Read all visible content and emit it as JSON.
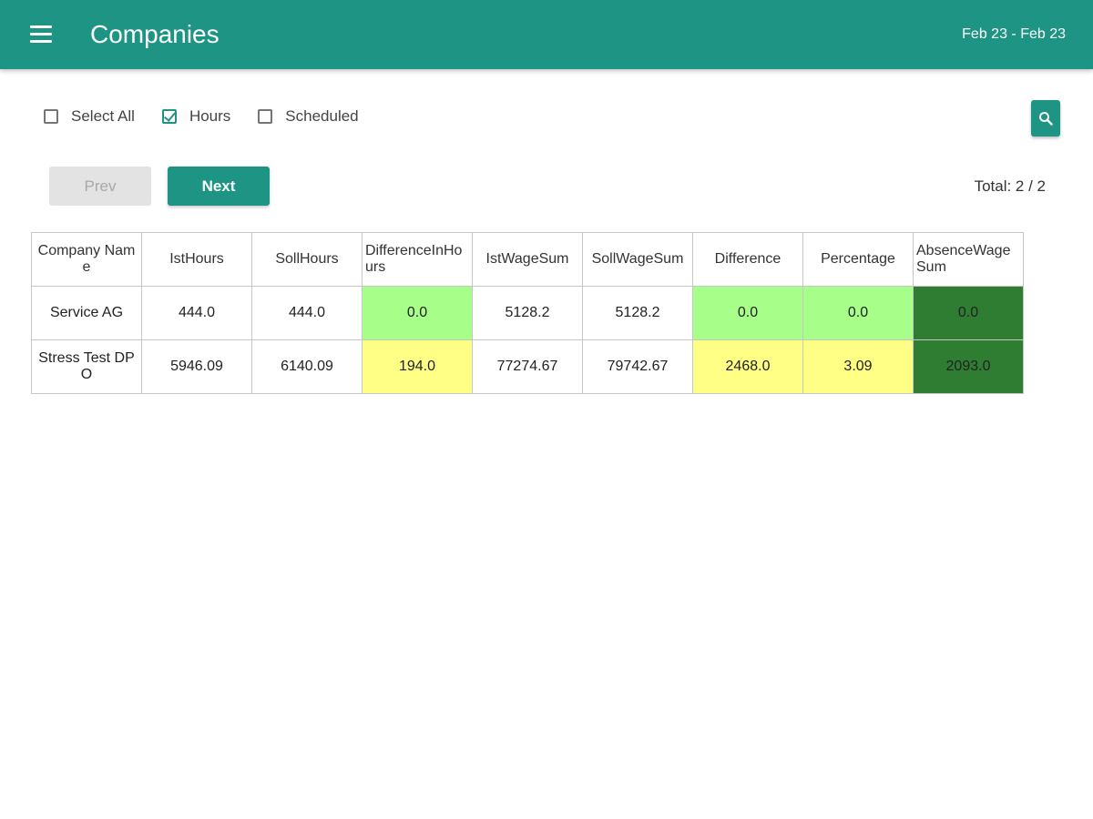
{
  "header": {
    "title": "Companies",
    "date_range": "Feb 23 - Feb 23"
  },
  "filters": [
    {
      "label": "Select All",
      "checked": false
    },
    {
      "label": "Hours",
      "checked": true
    },
    {
      "label": "Scheduled",
      "checked": false
    }
  ],
  "pagination": {
    "prev_label": "Prev",
    "next_label": "Next",
    "total": "Total: 2 / 2"
  },
  "table": {
    "columns": [
      "Company Name",
      "IstHours",
      "SollHours",
      "DifferenceInHours",
      "IstWageSum",
      "SollWageSum",
      "Difference",
      "Percentage",
      "AbsenceWageSum"
    ],
    "rows": [
      [
        "Service AG",
        "444.0",
        "444.0",
        "0.0",
        "5128.2",
        "5128.2",
        "0.0",
        "0.0",
        "0.0"
      ],
      [
        "Stress Test DPO",
        "5946.09",
        "6140.09",
        "194.0",
        "77274.67",
        "79742.67",
        "2468.0",
        "3.09",
        "2093.0"
      ]
    ]
  },
  "colors": {
    "primary": "#1e9584",
    "highlight_ok": "#a7ff8a",
    "highlight_warn": "#ffff85",
    "highlight_absence": "#2e7d32"
  },
  "icons": {
    "menu": "menu-icon",
    "search": "search-icon"
  }
}
